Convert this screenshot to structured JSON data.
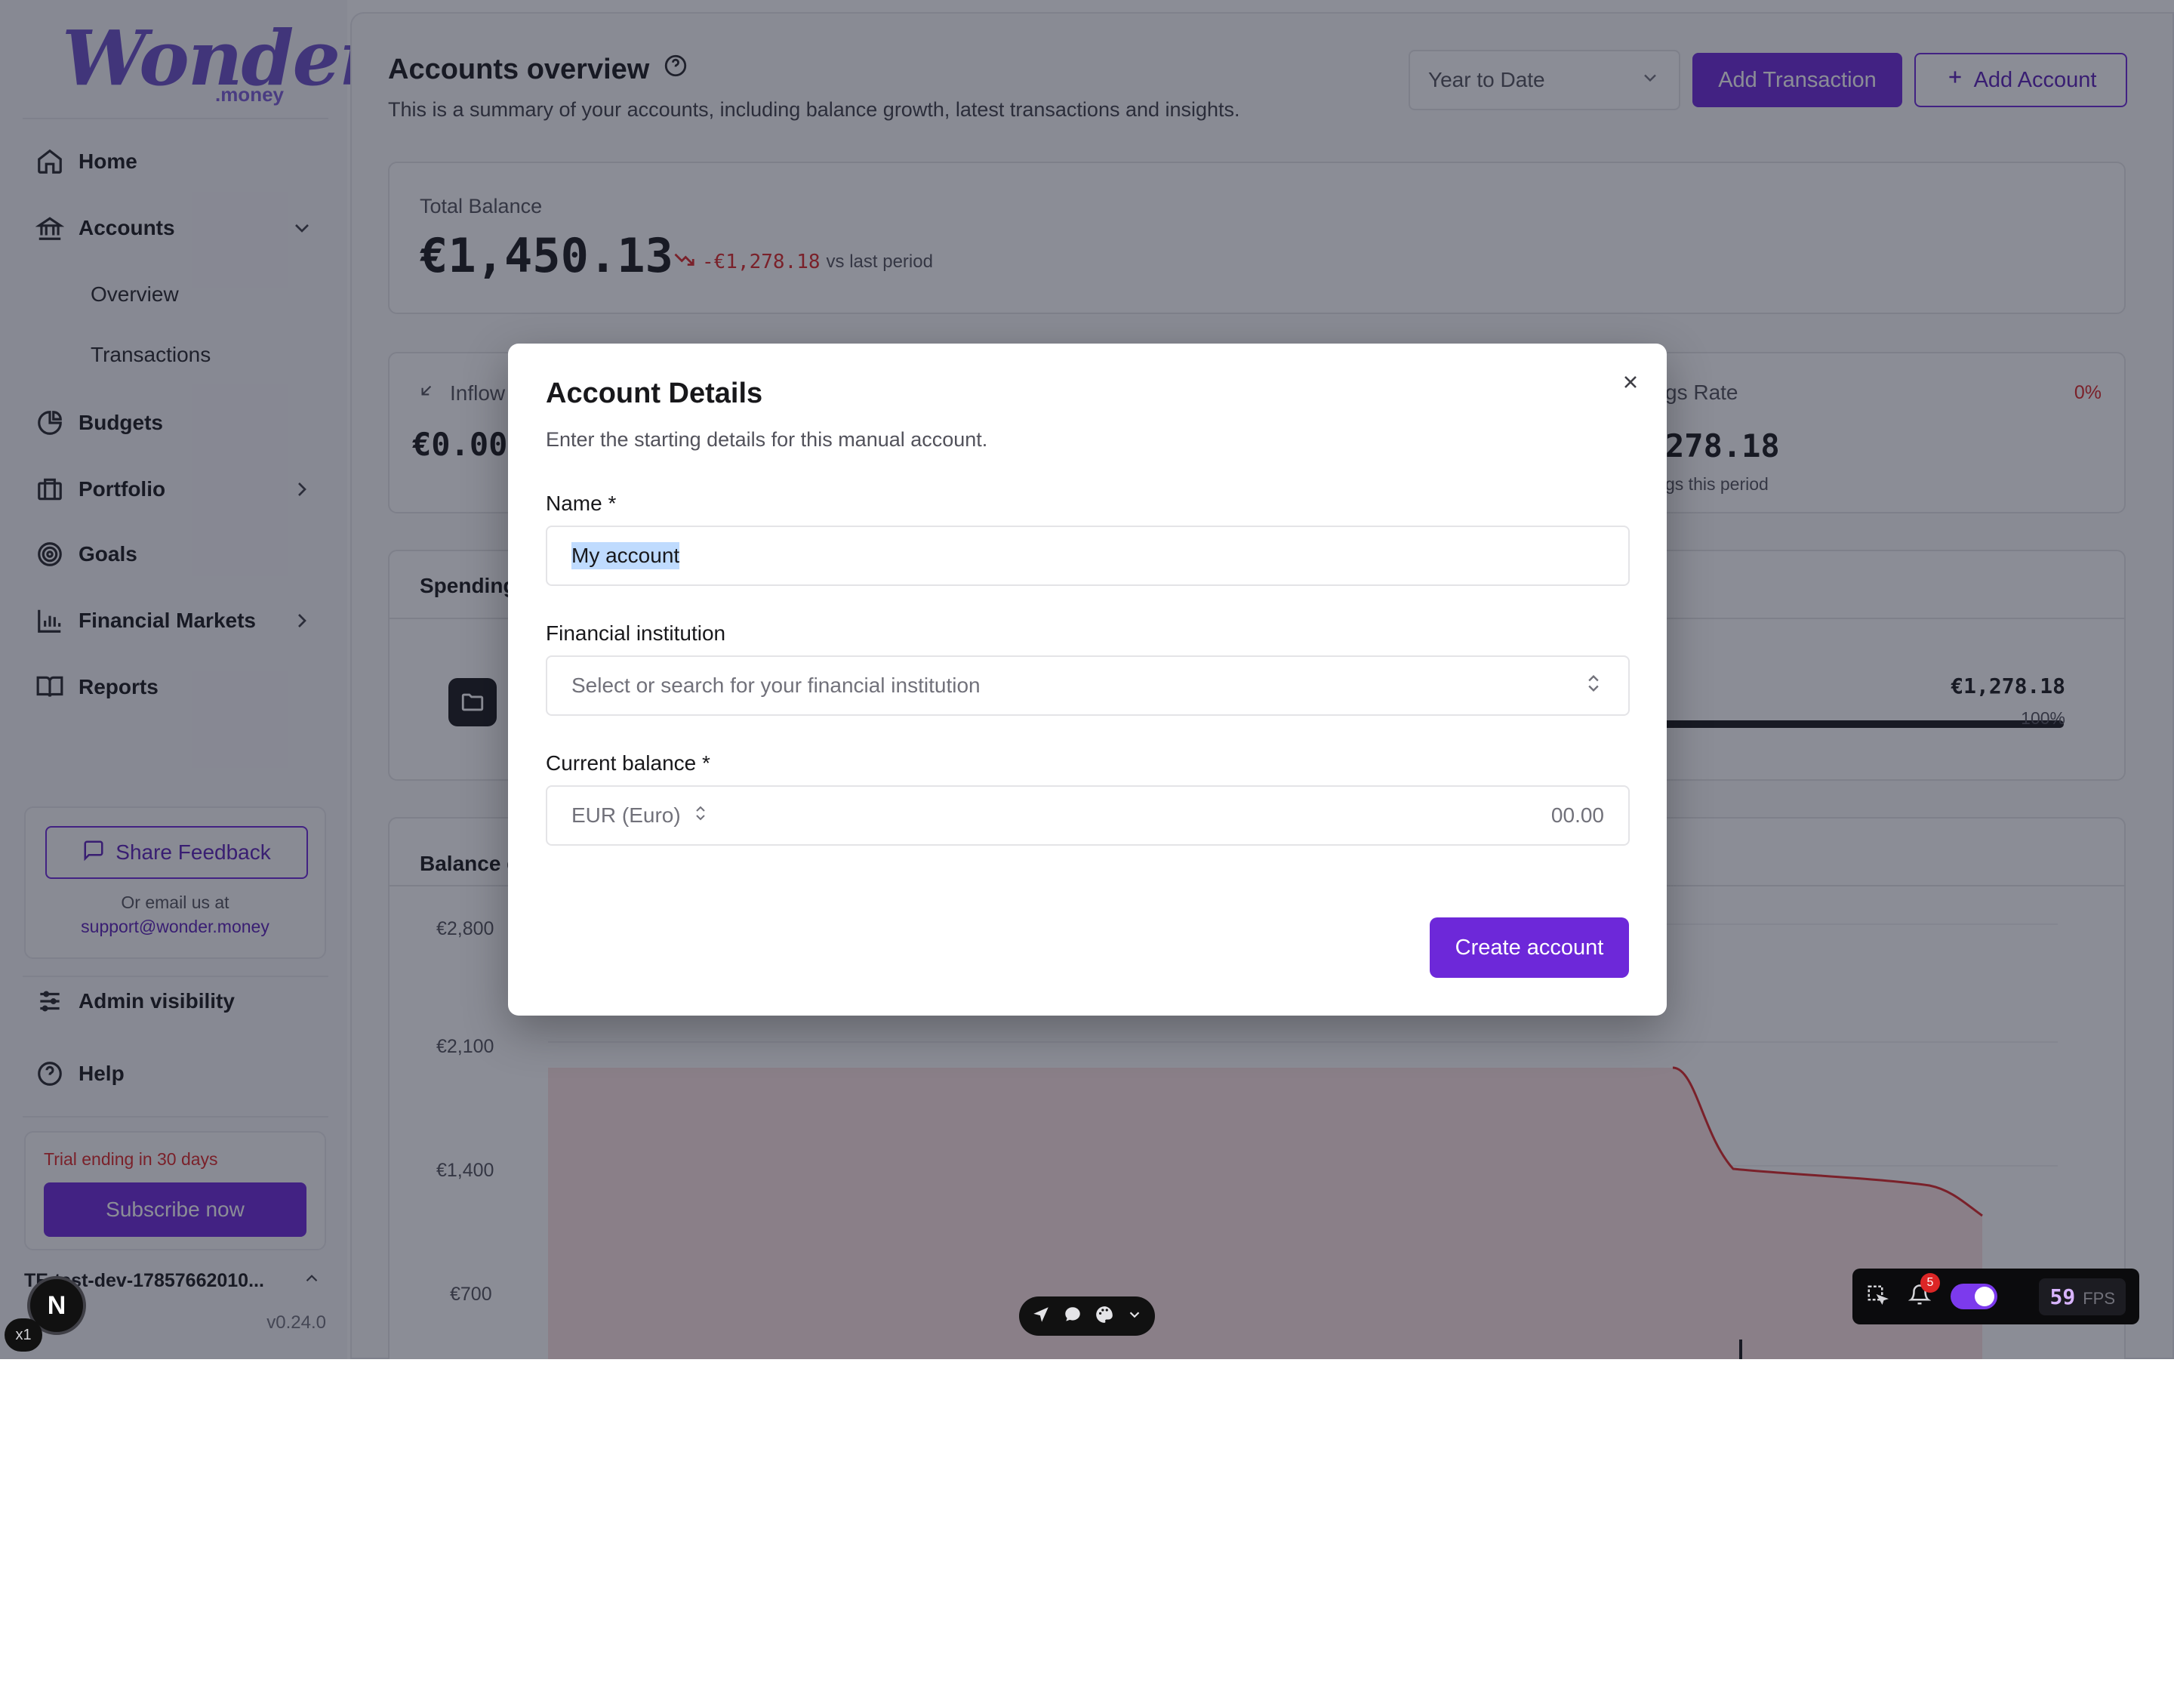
{
  "brand": {
    "logo_text": "Wonder",
    "logo_sub": ".money"
  },
  "sidebar": {
    "nav": [
      {
        "label": "Home",
        "icon": "home-icon"
      },
      {
        "label": "Accounts",
        "icon": "bank-icon"
      },
      {
        "label": "Budgets",
        "icon": "pie-chart-icon"
      },
      {
        "label": "Portfolio",
        "icon": "briefcase-icon"
      },
      {
        "label": "Goals",
        "icon": "target-icon"
      },
      {
        "label": "Financial Markets",
        "icon": "bar-chart-icon"
      },
      {
        "label": "Reports",
        "icon": "book-icon"
      }
    ],
    "accounts_sub": [
      "Overview",
      "Transactions"
    ],
    "feedback": {
      "button": "Share Feedback",
      "note": "Or email us at",
      "email": "support@wonder.money"
    },
    "admin": "Admin visibility",
    "help": "Help",
    "trial": {
      "text": "Trial ending in 30 days",
      "button": "Subscribe now"
    },
    "user": {
      "initials": "TE",
      "name": "test-dev-17857662010..."
    },
    "version": "v0.24.0",
    "dev_badge": "N",
    "zoom_badge": "x1"
  },
  "header": {
    "title": "Accounts overview",
    "subtitle": "This is a summary of your accounts, including balance growth, latest transactions and insights.",
    "range": "Year to Date",
    "add_transaction": "Add Transaction",
    "add_account": "Add Account"
  },
  "total_balance": {
    "label": "Total Balance",
    "value": "€1,450.13",
    "change": "-€1,278.18",
    "change_suffix": "vs last period"
  },
  "stats": {
    "inflow_label": "Inflow",
    "inflow_value": "€0.00",
    "savings_label": "gs Rate",
    "savings_pct": "0%",
    "savings_value": "278.18",
    "savings_sub": "gs this period"
  },
  "spending": {
    "title": "Spending",
    "amount": "€1,278.18",
    "percent": "100%",
    "progress": 1.0
  },
  "balance_chart": {
    "title": "Balance g",
    "y_ticks": [
      "€2,800",
      "€2,100",
      "€1,400",
      "€700"
    ]
  },
  "modal": {
    "title": "Account Details",
    "description": "Enter the starting details for this manual account.",
    "name_label": "Name *",
    "name_value": "My account",
    "institution_label": "Financial institution",
    "institution_placeholder": "Select or search for your financial institution",
    "balance_label": "Current balance *",
    "currency": "EUR (Euro)",
    "balance_placeholder": "00.00",
    "submit": "Create account"
  },
  "devtools": {
    "fps": "59",
    "fps_label": "FPS",
    "notifications": "5"
  },
  "colors": {
    "accent": "#6d28d9",
    "negative": "#dc2626",
    "chart_line": "#dc2626"
  }
}
